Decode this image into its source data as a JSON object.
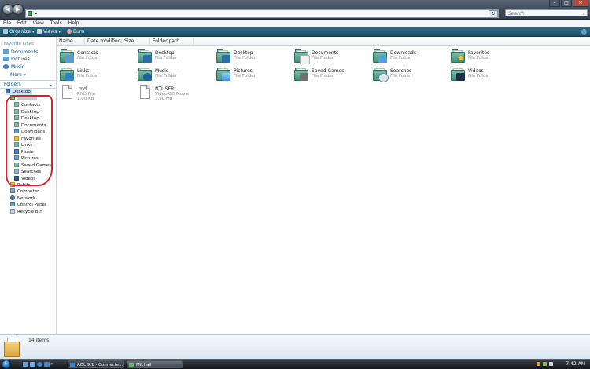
{
  "address": {
    "separator": "▸"
  },
  "search": {
    "placeholder": "Search"
  },
  "menu": [
    "File",
    "Edit",
    "View",
    "Tools",
    "Help"
  ],
  "toolbar": {
    "organize": "Organize",
    "views": "Views",
    "burn": "Burn"
  },
  "nav": {
    "favorite_links_heading": "Favorite Links",
    "favorites": [
      "Documents",
      "Pictures",
      "Music"
    ],
    "more": "More",
    "folders_heading": "Folders",
    "tree": {
      "desktop": "Desktop",
      "user_children": [
        "Contacts",
        "Desktop",
        "Desktop",
        "Documents",
        "Downloads",
        "Favorites",
        "Links",
        "Music",
        "Pictures",
        "Saved Games",
        "Searches",
        "Videos"
      ],
      "others": [
        "Public",
        "Computer",
        "Network",
        "Control Panel",
        "Recycle Bin"
      ]
    }
  },
  "columns": [
    "Name",
    "Date modified",
    "Size",
    "Folder path"
  ],
  "files": [
    {
      "name": "Contacts",
      "type": "File Folder"
    },
    {
      "name": "Desktop",
      "type": "File Folder"
    },
    {
      "name": "Desktop",
      "type": "File Folder"
    },
    {
      "name": "Documents",
      "type": "File Folder"
    },
    {
      "name": "Downloads",
      "type": "File Folder"
    },
    {
      "name": "Favorites",
      "type": "File Folder"
    },
    {
      "name": "Links",
      "type": "File Folder"
    },
    {
      "name": "Music",
      "type": "File Folder"
    },
    {
      "name": "Pictures",
      "type": "File Folder"
    },
    {
      "name": "Saved Games",
      "type": "File Folder"
    },
    {
      "name": "Searches",
      "type": "File Folder"
    },
    {
      "name": "Videos",
      "type": "File Folder"
    },
    {
      "name": ".rnd",
      "type": "RND File",
      "size": "1.00 KB"
    },
    {
      "name": "NTUSER",
      "type": "Video CD Movie",
      "size": "3.50 MB"
    }
  ],
  "status": {
    "item_count": "14 items"
  },
  "taskbar": {
    "tasks": [
      "AOL 9.1 - Connecte...",
      "Mikhail"
    ],
    "clock": "7:42 AM"
  },
  "colors": {
    "toolbar": "#1d4e66",
    "folder": "#3f8d78",
    "annotation_circle": "#d81e2c"
  }
}
